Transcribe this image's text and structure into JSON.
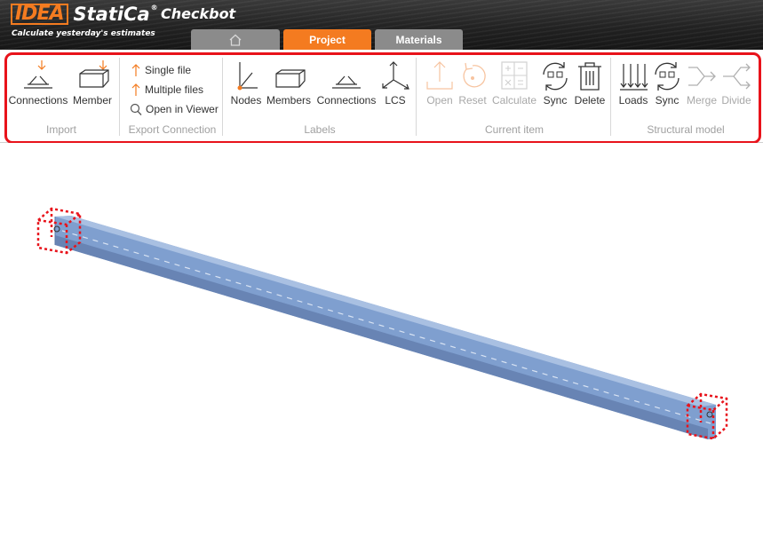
{
  "app": {
    "logo_idea": "IDEA",
    "logo_statica": "StatiCa",
    "logo_reg": "®",
    "name": "Checkbot",
    "tagline": "Calculate yesterday's estimates"
  },
  "tabs": [
    {
      "label": "",
      "icon": "home-icon"
    },
    {
      "label": "Project"
    },
    {
      "label": "Materials"
    }
  ],
  "ribbon": {
    "groups": {
      "import": "Import",
      "export": "Export Connection",
      "labels": "Labels",
      "current": "Current item",
      "structural": "Structural model"
    },
    "import": {
      "connections": "Connections",
      "member": "Member"
    },
    "export": {
      "single_file": "Single file",
      "multiple_files": "Multiple files",
      "open_viewer": "Open in Viewer"
    },
    "labels": {
      "nodes": "Nodes",
      "members": "Members",
      "connections": "Connections",
      "lcs": "LCS"
    },
    "current": {
      "open": "Open",
      "reset": "Reset",
      "calculate": "Calculate",
      "sync": "Sync",
      "delete": "Delete"
    },
    "structural": {
      "loads": "Loads",
      "sync": "Sync",
      "merge": "Merge",
      "divide": "Divide"
    }
  },
  "colors": {
    "accent": "#f47b20",
    "tab_inactive": "#8b8b8b",
    "highlight": "#e8131b",
    "beam": "#7f9fcf",
    "disabled": "#a8a8a8"
  }
}
